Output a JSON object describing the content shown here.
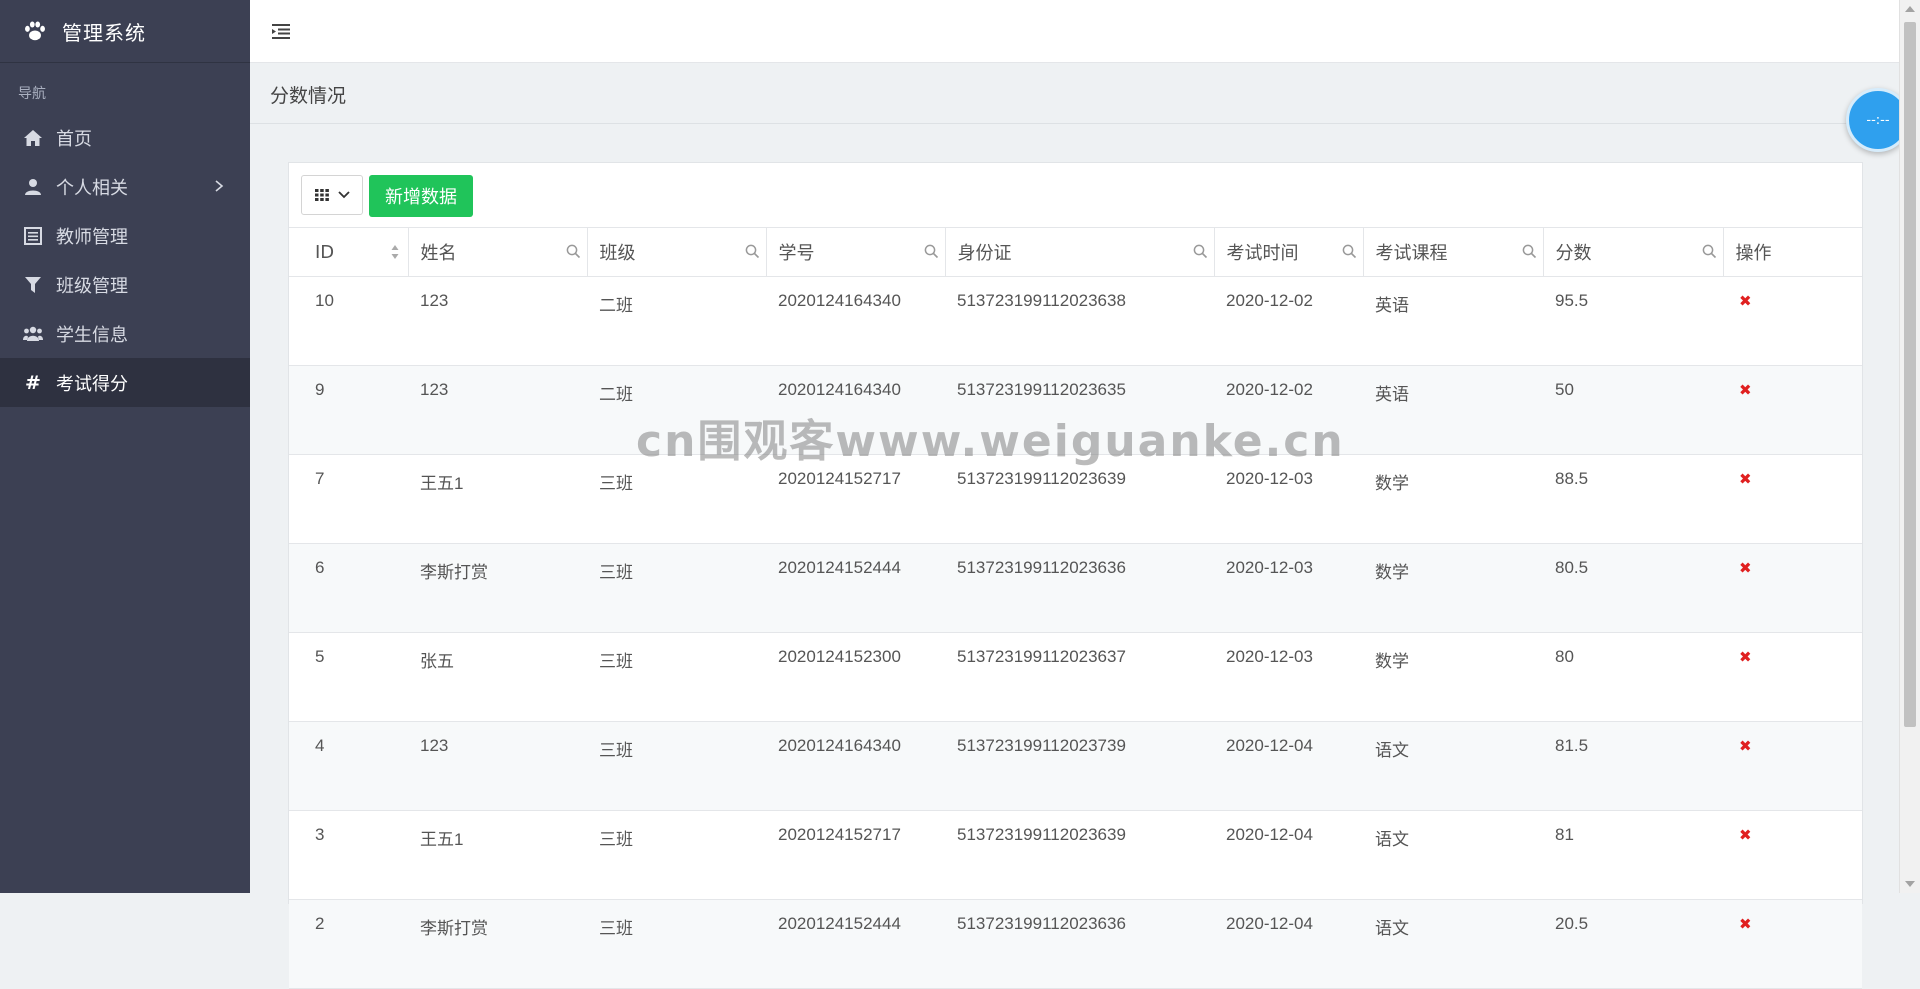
{
  "app": {
    "title": "管理系统"
  },
  "sidebar": {
    "caption": "导航",
    "items": [
      {
        "label": "首页",
        "icon": "home-icon"
      },
      {
        "label": "个人相关",
        "icon": "user-icon"
      },
      {
        "label": "教师管理",
        "icon": "list-icon"
      },
      {
        "label": "班级管理",
        "icon": "filter-icon"
      },
      {
        "label": "学生信息",
        "icon": "users-icon"
      },
      {
        "label": "考试得分",
        "icon": "hash-icon",
        "active": true
      }
    ]
  },
  "page": {
    "title": "分数情况"
  },
  "clock": {
    "text": "--:--"
  },
  "toolbar": {
    "add_label": "新增数据"
  },
  "table": {
    "headers": [
      "ID",
      "姓名",
      "班级",
      "学号",
      "身份证",
      "考试时间",
      "考试课程",
      "分数",
      "操作"
    ],
    "rows": [
      [
        "10",
        "123",
        "二班",
        "2020124164340",
        "513723199112023638",
        "2020-12-02",
        "英语",
        "95.5"
      ],
      [
        "9",
        "123",
        "二班",
        "2020124164340",
        "513723199112023635",
        "2020-12-02",
        "英语",
        "50"
      ],
      [
        "7",
        "王五1",
        "三班",
        "2020124152717",
        "513723199112023639",
        "2020-12-03",
        "数学",
        "88.5"
      ],
      [
        "6",
        "李斯打赏",
        "三班",
        "2020124152444",
        "513723199112023636",
        "2020-12-03",
        "数学",
        "80.5"
      ],
      [
        "5",
        "张五",
        "三班",
        "2020124152300",
        "513723199112023637",
        "2020-12-03",
        "数学",
        "80"
      ],
      [
        "4",
        "123",
        "三班",
        "2020124164340",
        "513723199112023739",
        "2020-12-04",
        "语文",
        "81.5"
      ],
      [
        "3",
        "王五1",
        "三班",
        "2020124152717",
        "513723199112023639",
        "2020-12-04",
        "语文",
        "81"
      ],
      [
        "2",
        "李斯打赏",
        "三班",
        "2020124152444",
        "513723199112023636",
        "2020-12-04",
        "语文",
        "20.5"
      ]
    ],
    "delete_glyph": "✖"
  },
  "watermark": "cn围观客www.weiguanke.cn",
  "colors": {
    "sidebar": "#3c4053",
    "active": "#2e3140",
    "accent_green": "#20c45a",
    "delete_red": "#e02020",
    "float_blue": "#2fa0ee"
  }
}
